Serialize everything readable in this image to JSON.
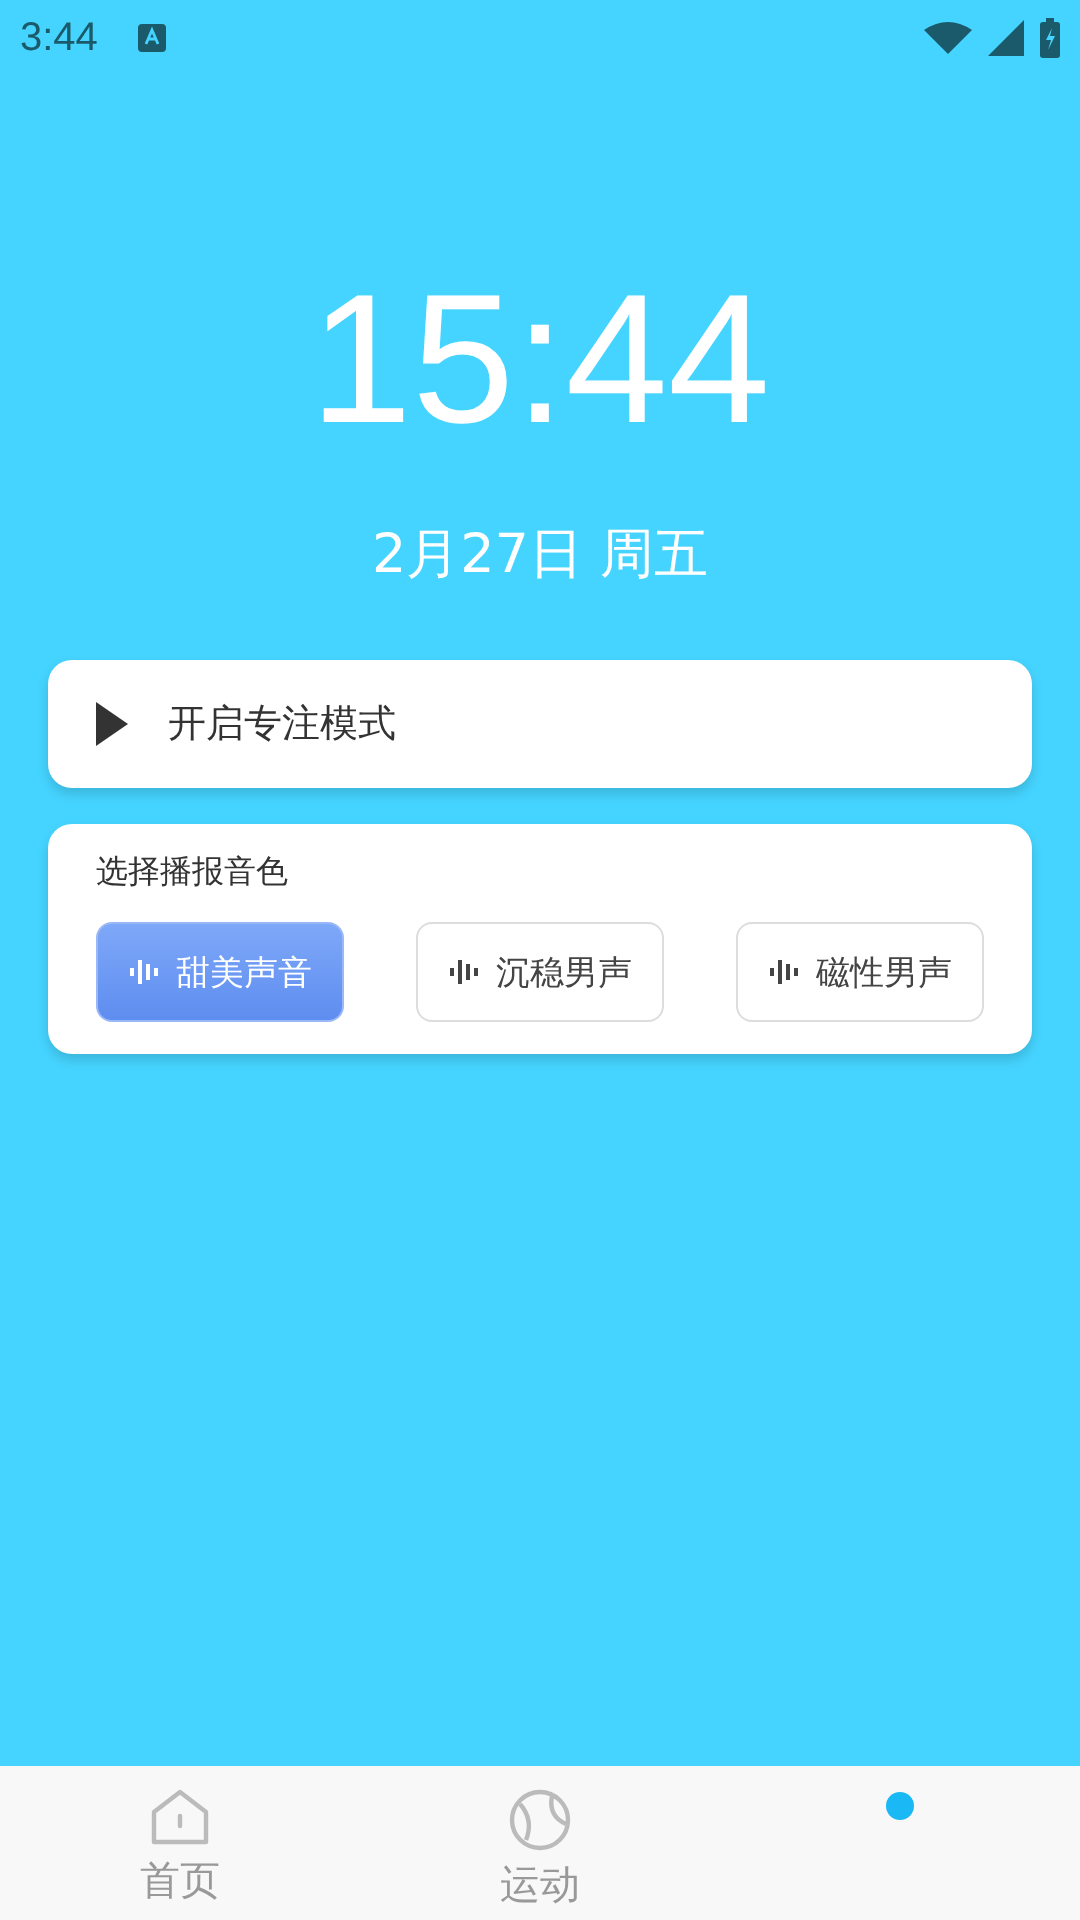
{
  "status_bar": {
    "time": "3:44"
  },
  "clock": {
    "time": "15:44",
    "date": "2月27日 周五"
  },
  "focus_card": {
    "label": "开启专注模式"
  },
  "voice_card": {
    "title": "选择播报音色",
    "options": [
      {
        "label": "甜美声音",
        "selected": true
      },
      {
        "label": "沉稳男声",
        "selected": false
      },
      {
        "label": "磁性男声",
        "selected": false
      }
    ]
  },
  "bottom_nav": [
    {
      "kind": "home",
      "label": "首页",
      "selected": false
    },
    {
      "kind": "sport",
      "label": "运动",
      "selected": false
    },
    {
      "kind": "dot",
      "selected": true
    }
  ]
}
